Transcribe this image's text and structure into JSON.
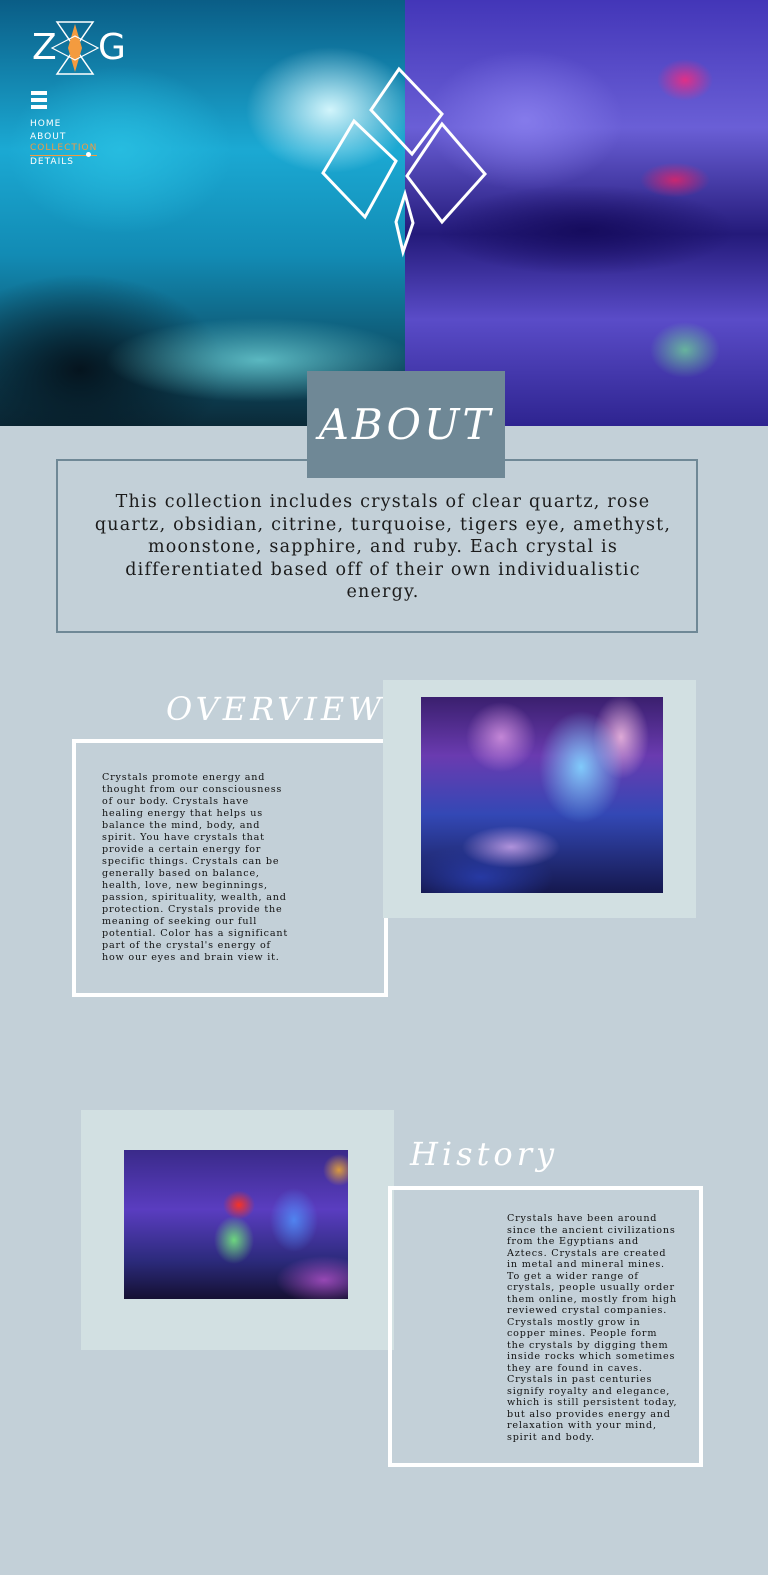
{
  "brand": {
    "logo_left": "Z",
    "logo_right": "G",
    "colors": {
      "accent": "#f39b3f",
      "slate": "#6f8896",
      "background": "#c3d0d8",
      "panel": "#d2e0e2"
    }
  },
  "nav": {
    "menu_icon": "hamburger-icon",
    "items": [
      {
        "label": "HOME"
      },
      {
        "label": "ABOUT"
      },
      {
        "label": "COLLECTION",
        "active": true
      },
      {
        "label": "DETAILS"
      }
    ]
  },
  "about": {
    "title": "ABOUT",
    "text": "This collection includes crystals of clear quartz, rose quartz, obsidian, citrine, turquoise, tigers eye, amethyst, moonstone, sapphire, and ruby. Each crystal is differentiated based off of their own individualistic energy."
  },
  "overview": {
    "title": "OVERVIEW",
    "text": "Crystals promote energy and thought from our consciousness of our body. Crystals have healing energy that helps us balance the mind, body, and spirit. You have crystals that provide a certain energy for specific things. Crystals can be generally based on balance, health, love, new beginnings, passion, spirituality, wealth, and protection. Crystals provide the meaning of seeking our full potential. Color has a significant part of the crystal's energy of how our eyes and brain view it."
  },
  "history": {
    "title": "History",
    "text": "Crystals have been around since the ancient civilizations from the Egyptians and Aztecs. Crystals are created in metal and mineral mines. To get a wider range of crystals, people usually order them online, mostly from high reviewed crystal companies. Crystals mostly grow in copper mines. People form the crystals by digging them inside rocks which sometimes they are found in caves. Crystals in past centuries signify royalty and elegance, which is still persistent today, but also provides energy and relaxation with your mind, spirit and body."
  }
}
